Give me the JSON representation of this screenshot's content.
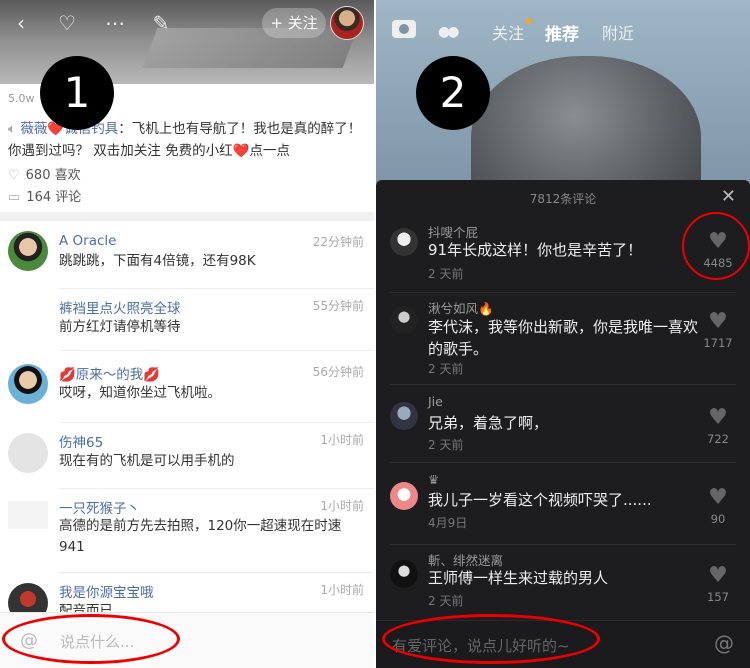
{
  "left": {
    "badge": "1",
    "nav": {
      "back_glyph": "‹",
      "heart_glyph": "♡",
      "more_glyph": "⋯",
      "edit_glyph": "✎",
      "follow_label": "+ 关注"
    },
    "views": "5.0w",
    "description": {
      "author": "薇薇❤️诚信钓具",
      "body": "：飞机上也有导航了！我也是真的醉了！你遇到过吗？  双击加关注  免费的小红",
      "heart": "❤️",
      "tail": "点一点"
    },
    "likes": "680 喜欢",
    "comments_count": "164 评论",
    "comments": [
      {
        "name": "A Oracle",
        "time": "22分钟前",
        "text": "跳跳跳，下面有4倍镜，还有98K"
      },
      {
        "name": "裤裆里点火照亮全球",
        "time": "55分钟前",
        "text": "前方红灯请停机等待"
      },
      {
        "name": "💋原来～的我💋",
        "time": "56分钟前",
        "text": "哎呀，知道你坐过飞机啦。"
      },
      {
        "name": "伤神65",
        "time": "1小时前",
        "text": "现在有的飞机是可以用手机的"
      },
      {
        "name": "一只死猴子丶",
        "time": "1小时前",
        "text": "高德的是前方先去拍照，120你一超速现在时速941"
      },
      {
        "name": "我是你源宝宝哦",
        "time": "1小时前",
        "text": "配音而已"
      }
    ],
    "input": {
      "at": "@",
      "placeholder": "说点什么..."
    }
  },
  "right": {
    "badge": "2",
    "tabs": [
      "关注",
      "推荐",
      "附近"
    ],
    "sheet_title": "7812条评论",
    "close_glyph": "✕",
    "comments": [
      {
        "name": "抖嗖个屁",
        "text": "91年长成这样！你也是辛苦了！",
        "time": "2 天前",
        "likes": "4485"
      },
      {
        "name": "湫兮如风",
        "flame": "🔥",
        "text": "李代沫，我等你出新歌，你是我唯一喜欢的歌手。",
        "time": "2 天前",
        "likes": "1717"
      },
      {
        "name": "Jie",
        "text": "兄弟，着急了啊，",
        "time": "2 天前",
        "likes": "722"
      },
      {
        "name": "♛",
        "text": "我儿子一岁看这个视频吓哭了......",
        "time": "4月9日",
        "likes": "90"
      },
      {
        "name": "斬、绯然迷离",
        "text": "王师傅一样生来过载的男人",
        "time": "2 天前",
        "likes": "157"
      }
    ],
    "input": {
      "placeholder": "有爱评论，说点儿好听的~",
      "at": "@"
    }
  },
  "colors": {
    "link_blue": "#4a6ea9",
    "heart_red": "#e01d33",
    "annotation_red": "#e00",
    "tab_dot": "#f5a623"
  }
}
